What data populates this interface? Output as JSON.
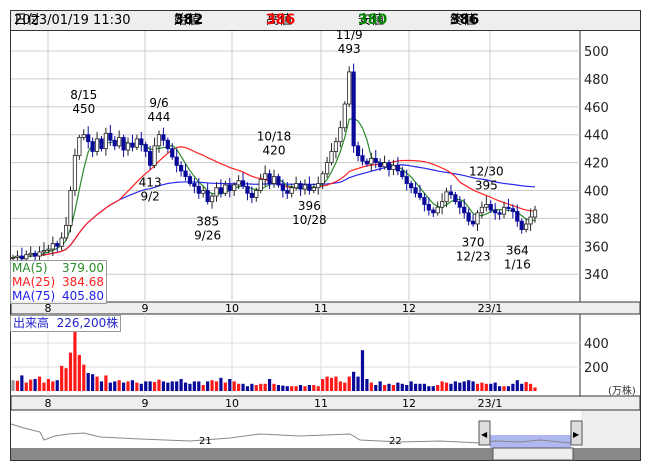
{
  "header": {
    "date_label": "日付",
    "date": "2023/01/19 11:30",
    "open_label": "始値",
    "open": "382",
    "high_label": "高値",
    "high": "386",
    "low_label": "安値",
    "low": "380",
    "close_label": "終値",
    "close": "386"
  },
  "colors": {
    "up": "#ffffff",
    "down": "#0a0a9a",
    "ma5": "#2a8a2a",
    "ma25": "#ff2020",
    "ma75": "#2a2aee",
    "vol_up": "#ff1a1a",
    "vol_down": "#0a0a9a",
    "vol_flat": "#999999"
  },
  "legend": {
    "ma5_label": "MA(5)",
    "ma5": "379.00",
    "ma25_label": "MA(25)",
    "ma25": "384.68",
    "ma75_label": "MA(75)",
    "ma75": "405.80"
  },
  "volume_label": {
    "label": "出来高",
    "value": "226,200株"
  },
  "volume_unit": "(万株)",
  "navigator": {
    "labels": [
      "21",
      "22"
    ]
  },
  "chart_data": {
    "type": "candlestick",
    "price_ticks": [
      "500",
      "480",
      "460",
      "440",
      "420",
      "400",
      "380",
      "360",
      "340"
    ],
    "ylim": [
      330,
      505
    ],
    "month_labels": [
      "8",
      "9",
      "10",
      "11",
      "12",
      "23/1"
    ],
    "volume_ticks": [
      "400",
      "200"
    ],
    "closes": [
      352,
      353,
      351,
      354,
      355,
      353,
      356,
      357,
      358,
      362,
      360,
      366,
      375,
      400,
      425,
      438,
      440,
      435,
      428,
      437,
      430,
      441,
      436,
      432,
      438,
      429,
      434,
      431,
      437,
      433,
      428,
      418,
      432,
      440,
      436,
      430,
      424,
      418,
      414,
      410,
      405,
      403,
      398,
      400,
      392,
      396,
      402,
      398,
      404,
      400,
      404,
      407,
      403,
      398,
      395,
      400,
      408,
      412,
      405,
      410,
      404,
      400,
      398,
      402,
      405,
      401,
      404,
      400,
      402,
      405,
      412,
      420,
      428,
      435,
      445,
      462,
      485,
      432,
      425,
      421,
      419,
      423,
      420,
      417,
      420,
      415,
      418,
      414,
      410,
      405,
      402,
      398,
      395,
      390,
      386,
      384,
      388,
      392,
      399,
      397,
      392,
      388,
      384,
      378,
      376,
      384,
      388,
      390,
      386,
      384,
      383,
      388,
      387,
      385,
      378,
      372,
      376,
      381,
      386
    ],
    "volumes": [
      90,
      85,
      130,
      70,
      95,
      100,
      120,
      70,
      100,
      80,
      90,
      210,
      190,
      320,
      500,
      300,
      220,
      150,
      140,
      120,
      80,
      130,
      70,
      80,
      90,
      70,
      80,
      90,
      70,
      60,
      80,
      80,
      75,
      95,
      80,
      70,
      80,
      80,
      100,
      70,
      60,
      80,
      80,
      50,
      80,
      90,
      80,
      110,
      70,
      100,
      80,
      60,
      60,
      40,
      60,
      50,
      60,
      60,
      100,
      60,
      50,
      45,
      40,
      40,
      40,
      50,
      40,
      50,
      50,
      40,
      100,
      120,
      110,
      120,
      80,
      70,
      120,
      160,
      120,
      340,
      100,
      70,
      50,
      80,
      50,
      60,
      50,
      70,
      60,
      50,
      80,
      60,
      60,
      60,
      40,
      40,
      50,
      80,
      70,
      60,
      80,
      70,
      80,
      90,
      80,
      60,
      70,
      60,
      60,
      70,
      40,
      40,
      40,
      60,
      90,
      60,
      75,
      60,
      30
    ],
    "annotations": [
      {
        "date": "8/15",
        "price": "450",
        "idx": 16,
        "pos": "above"
      },
      {
        "date": "9/6",
        "price": "444",
        "idx": 33,
        "pos": "above"
      },
      {
        "date": "9/2",
        "price": "413",
        "idx": 31,
        "pos": "below"
      },
      {
        "date": "9/26",
        "price": "385",
        "idx": 44,
        "pos": "below"
      },
      {
        "date": "10/18",
        "price": "420",
        "idx": 59,
        "pos": "above"
      },
      {
        "date": "10/28",
        "price": "396",
        "idx": 67,
        "pos": "below"
      },
      {
        "date": "11/9",
        "price": "493",
        "idx": 76,
        "pos": "above"
      },
      {
        "date": "12/30",
        "price": "395",
        "idx": 107,
        "pos": "above"
      },
      {
        "date": "12/23",
        "price": "370",
        "idx": 104,
        "pos": "below"
      },
      {
        "date": "1/16",
        "price": "364",
        "idx": 114,
        "pos": "below"
      }
    ]
  }
}
